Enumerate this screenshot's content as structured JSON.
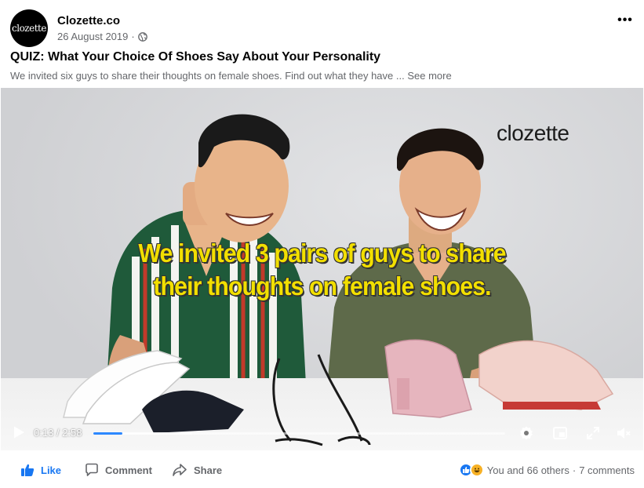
{
  "post": {
    "page_name": "Clozette.co",
    "avatar_text": "clozette",
    "date": "26 August 2019",
    "meta_separator": "·",
    "privacy_icon": "globe-icon",
    "more_icon": "•••",
    "title": "QUIZ: What Your Choice Of Shoes Say About Your Personality",
    "description": "We invited six guys to share their thoughts on female shoes. Find out what they have ...",
    "see_more": "See more"
  },
  "video": {
    "watermark": "clozette",
    "caption_line1": "We invited 3 pairs of guys to share",
    "caption_line2": "their thoughts on female shoes.",
    "current_time": "0:13",
    "duration": "2:58",
    "time_separator": "/",
    "progress_fraction": 0.07,
    "buffered_fraction": 0.24,
    "controls": [
      "play-icon",
      "settings-icon",
      "pip-icon",
      "fullscreen-icon",
      "mute-icon"
    ]
  },
  "actions": {
    "like": "Like",
    "comment": "Comment",
    "share": "Share"
  },
  "engagement": {
    "reactions_text": "You and 66 others",
    "separator": "·",
    "comments_text": "7 comments"
  },
  "colors": {
    "accent": "#1877f2",
    "progress": "#2d88ff",
    "caption": "#f2df00",
    "secondary_text": "#65676b"
  }
}
